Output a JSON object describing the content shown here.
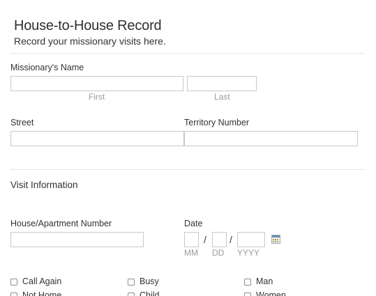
{
  "header": {
    "title": "House-to-House Record",
    "subtitle": "Record your missionary visits here."
  },
  "missionary_name": {
    "label": "Missionary's Name",
    "first_sublabel": "First",
    "last_sublabel": "Last",
    "first_value": "",
    "last_value": ""
  },
  "street": {
    "label": "Street",
    "value": ""
  },
  "territory": {
    "label": "Territory Number",
    "value": ""
  },
  "visit_section": {
    "title": "Visit Information"
  },
  "house_number": {
    "label": "House/Apartment Number",
    "value": ""
  },
  "date": {
    "label": "Date",
    "separator": "/",
    "mm_label": "MM",
    "dd_label": "DD",
    "yyyy_label": "YYYY",
    "calendar_icon": "calendar-icon"
  },
  "checkboxes": [
    {
      "label": "Call Again",
      "checked": false
    },
    {
      "label": "Busy",
      "checked": false
    },
    {
      "label": "Man",
      "checked": false
    },
    {
      "label": "Not Home",
      "checked": false
    },
    {
      "label": "Child",
      "checked": false
    },
    {
      "label": "Women",
      "checked": false
    }
  ],
  "colors": {
    "border": "#c8c8c8",
    "sublabel": "#9a9a9a",
    "text": "#333333"
  }
}
